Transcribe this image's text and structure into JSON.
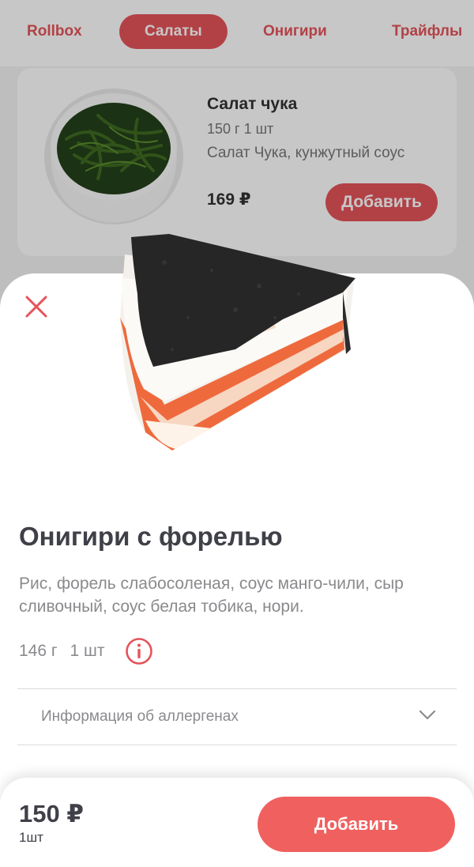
{
  "categories": {
    "items": [
      {
        "label": "Rollbox"
      },
      {
        "label": "Салаты",
        "active": true
      },
      {
        "label": "Онигири"
      },
      {
        "label": "Трайфлы"
      }
    ]
  },
  "background_product": {
    "title": "Салат чука",
    "weight": "150 г 1 шт",
    "description": "Салат Чука, кунжутный соус",
    "price": "169 ₽",
    "add_label": "Добавить"
  },
  "modal": {
    "title": "Онигири с форелью",
    "description": "Рис, форель слабосоленая, соус манго-чили, сыр сливочный, соус белая тобика, нори.",
    "weight": "146 г",
    "count": "1 шт",
    "allergen_label": "Информация об аллергенах"
  },
  "bottom_bar": {
    "price": "150 ₽",
    "quantity": "1шт",
    "add_label": "Добавить"
  },
  "icons": {
    "close": "close-icon",
    "info": "info-icon",
    "chevron": "chevron-down-icon"
  },
  "colors": {
    "accent": "#e5545a",
    "add_button": "#f0605f",
    "title_text": "#3f4048",
    "muted_text": "#8a8a8e"
  }
}
